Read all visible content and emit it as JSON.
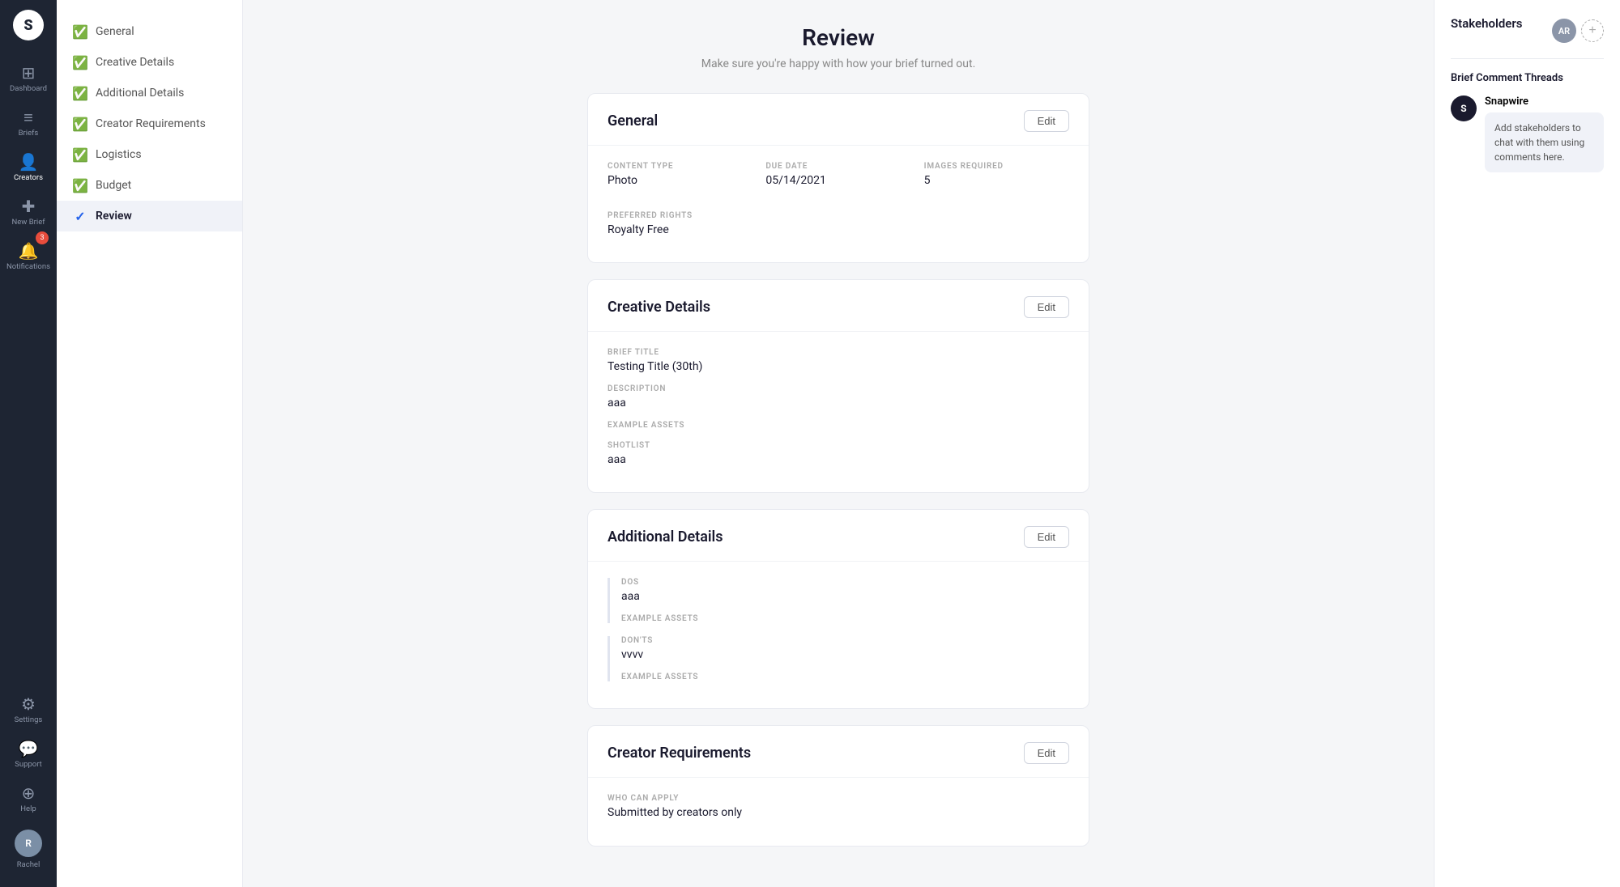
{
  "app": {
    "logo": "S"
  },
  "leftnav": {
    "items": [
      {
        "id": "dashboard",
        "label": "Dashboard",
        "icon": "⊞"
      },
      {
        "id": "briefs",
        "label": "Briefs",
        "icon": "📋"
      },
      {
        "id": "creators",
        "label": "Creators",
        "icon": "👥"
      },
      {
        "id": "new-brief",
        "label": "New Brief",
        "icon": "✚"
      },
      {
        "id": "notifications",
        "label": "Notifications",
        "icon": "🔔",
        "badge": "3"
      },
      {
        "id": "settings",
        "label": "Settings",
        "icon": "⚙"
      },
      {
        "id": "support",
        "label": "Support",
        "icon": "💬"
      },
      {
        "id": "help",
        "label": "Help",
        "icon": "⊕"
      }
    ],
    "user": {
      "name": "Rachel",
      "initials": "R"
    }
  },
  "sidebar": {
    "items": [
      {
        "id": "general",
        "label": "General",
        "completed": true,
        "active": false
      },
      {
        "id": "creative-details",
        "label": "Creative Details",
        "completed": true,
        "active": false
      },
      {
        "id": "additional-details",
        "label": "Additional Details",
        "completed": true,
        "active": false
      },
      {
        "id": "creator-requirements",
        "label": "Creator Requirements",
        "completed": true,
        "active": false
      },
      {
        "id": "logistics",
        "label": "Logistics",
        "completed": true,
        "active": false
      },
      {
        "id": "budget",
        "label": "Budget",
        "completed": true,
        "active": false
      },
      {
        "id": "review",
        "label": "Review",
        "completed": false,
        "active": true
      }
    ]
  },
  "page": {
    "title": "Review",
    "subtitle": "Make sure you're happy with how your brief turned out."
  },
  "general_card": {
    "title": "General",
    "edit_label": "Edit",
    "fields": {
      "content_type_label": "CONTENT TYPE",
      "content_type_value": "Photo",
      "due_date_label": "DUE DATE",
      "due_date_value": "05/14/2021",
      "images_required_label": "IMAGES REQUIRED",
      "images_required_value": "5",
      "preferred_rights_label": "PREFERRED RIGHTS",
      "preferred_rights_value": "Royalty Free"
    }
  },
  "creative_details_card": {
    "title": "Creative Details",
    "edit_label": "Edit",
    "fields": {
      "brief_title_label": "BRIEF TITLE",
      "brief_title_value": "Testing Title (30th)",
      "description_label": "DESCRIPTION",
      "description_value": "aaa",
      "example_assets_label": "EXAMPLE ASSETS",
      "example_assets_value": "",
      "shotlist_label": "SHOTLIST",
      "shotlist_value": "aaa"
    }
  },
  "additional_details_card": {
    "title": "Additional Details",
    "edit_label": "Edit",
    "dos": {
      "label": "DOS",
      "value": "aaa",
      "example_assets_label": "EXAMPLE ASSETS"
    },
    "donts": {
      "label": "DON'TS",
      "value": "vvvv",
      "example_assets_label": "EXAMPLE ASSETS"
    }
  },
  "creator_requirements_card": {
    "title": "Creator Requirements",
    "edit_label": "Edit",
    "who_can_apply_label": "WHO CAN APPLY",
    "who_can_apply_value": "Submitted by creators only"
  },
  "right_panel": {
    "stakeholders_title": "Stakeholders",
    "user_initials": "AR",
    "comment_threads_title": "Brief Comment Threads",
    "snapwire_name": "Snapwire",
    "comment_text": "Add stakeholders to chat with them using comments here."
  }
}
